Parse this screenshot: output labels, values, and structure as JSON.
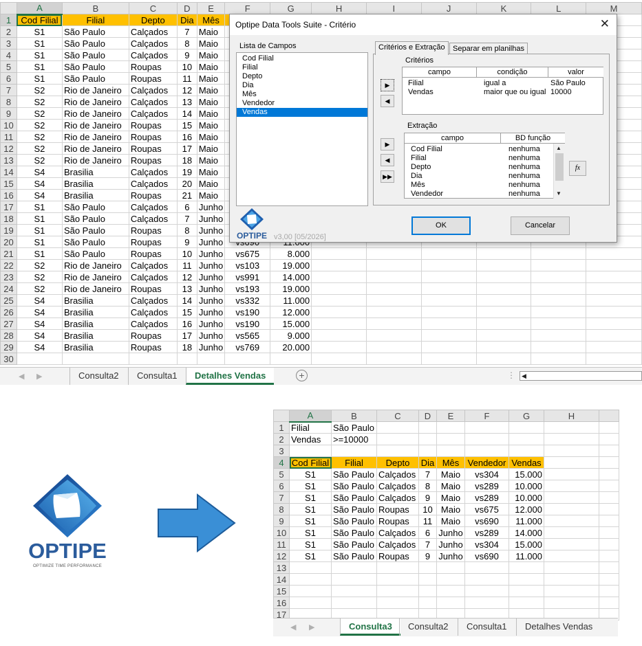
{
  "top_sheet": {
    "columns": [
      "A",
      "B",
      "C",
      "D",
      "E",
      "F",
      "G",
      "H",
      "I",
      "J",
      "K",
      "L",
      "M"
    ],
    "header_row": [
      "Cod Filial",
      "Filial",
      "Depto",
      "Dia",
      "Mês",
      "V",
      ""
    ],
    "rows": [
      [
        "S1",
        "São Paulo",
        "Calçados",
        "7",
        "Maio",
        "",
        ""
      ],
      [
        "S1",
        "São Paulo",
        "Calçados",
        "8",
        "Maio",
        "",
        ""
      ],
      [
        "S1",
        "São Paulo",
        "Calçados",
        "9",
        "Maio",
        "",
        ""
      ],
      [
        "S1",
        "São Paulo",
        "Roupas",
        "10",
        "Maio",
        "",
        ""
      ],
      [
        "S1",
        "São Paulo",
        "Roupas",
        "11",
        "Maio",
        "",
        ""
      ],
      [
        "S2",
        "Rio de Janeiro",
        "Calçados",
        "12",
        "Maio",
        "",
        ""
      ],
      [
        "S2",
        "Rio de Janeiro",
        "Calçados",
        "13",
        "Maio",
        "",
        ""
      ],
      [
        "S2",
        "Rio de Janeiro",
        "Calçados",
        "14",
        "Maio",
        "",
        ""
      ],
      [
        "S2",
        "Rio de Janeiro",
        "Roupas",
        "15",
        "Maio",
        "",
        ""
      ],
      [
        "S2",
        "Rio de Janeiro",
        "Roupas",
        "16",
        "Maio",
        "",
        ""
      ],
      [
        "S2",
        "Rio de Janeiro",
        "Roupas",
        "17",
        "Maio",
        "",
        ""
      ],
      [
        "S2",
        "Rio de Janeiro",
        "Roupas",
        "18",
        "Maio",
        "",
        ""
      ],
      [
        "S4",
        "Brasilia",
        "Calçados",
        "19",
        "Maio",
        "",
        ""
      ],
      [
        "S4",
        "Brasilia",
        "Calçados",
        "20",
        "Maio",
        "",
        ""
      ],
      [
        "S4",
        "Brasilia",
        "Roupas",
        "21",
        "Maio",
        "",
        ""
      ],
      [
        "S1",
        "São Paulo",
        "Calçados",
        "6",
        "Junho",
        "",
        ""
      ],
      [
        "S1",
        "São Paulo",
        "Calçados",
        "7",
        "Junho",
        "",
        ""
      ],
      [
        "S1",
        "São Paulo",
        "Roupas",
        "8",
        "Junho",
        "",
        ""
      ],
      [
        "S1",
        "São Paulo",
        "Roupas",
        "9",
        "Junho",
        "vs690",
        "11.000"
      ],
      [
        "S1",
        "São Paulo",
        "Roupas",
        "10",
        "Junho",
        "vs675",
        "8.000"
      ],
      [
        "S2",
        "Rio de Janeiro",
        "Calçados",
        "11",
        "Junho",
        "vs103",
        "19.000"
      ],
      [
        "S2",
        "Rio de Janeiro",
        "Calçados",
        "12",
        "Junho",
        "vs991",
        "14.000"
      ],
      [
        "S2",
        "Rio de Janeiro",
        "Roupas",
        "13",
        "Junho",
        "vs193",
        "19.000"
      ],
      [
        "S4",
        "Brasilia",
        "Calçados",
        "14",
        "Junho",
        "vs332",
        "11.000"
      ],
      [
        "S4",
        "Brasilia",
        "Calçados",
        "15",
        "Junho",
        "vs190",
        "12.000"
      ],
      [
        "S4",
        "Brasilia",
        "Calçados",
        "16",
        "Junho",
        "vs190",
        "15.000"
      ],
      [
        "S4",
        "Brasilia",
        "Roupas",
        "17",
        "Junho",
        "vs565",
        "9.000"
      ],
      [
        "S4",
        "Brasilia",
        "Roupas",
        "18",
        "Junho",
        "vs769",
        "20.000"
      ],
      [
        "",
        "",
        "",
        "",
        "",
        "",
        ""
      ]
    ],
    "tabs": [
      "Consulta2",
      "Consulta1",
      "Detalhes Vendas"
    ],
    "active_tab": "Detalhes Vendas"
  },
  "dialog": {
    "title": "Optipe Data Tools Suite - Critério",
    "close": "✕",
    "fields_label": "Lista de Campos",
    "fields": [
      "Cod Filial",
      "Filial",
      "Depto",
      "Dia",
      "Mês",
      "Vendedor",
      "Vendas"
    ],
    "selected_field": "Vendas",
    "tabs": [
      "Critérios e Extração",
      "Separar em planilhas"
    ],
    "criteria": {
      "label": "Critérios",
      "headers": [
        "campo",
        "condição",
        "valor"
      ],
      "rows": [
        [
          "Filial",
          "igual a",
          "São Paulo"
        ],
        [
          "Vendas",
          "maior que ou igual",
          "10000"
        ]
      ]
    },
    "extraction": {
      "label": "Extração",
      "headers": [
        "campo",
        "BD função"
      ],
      "rows": [
        [
          "Cod Filial",
          "nenhuma"
        ],
        [
          "Filial",
          "nenhuma"
        ],
        [
          "Depto",
          "nenhuma"
        ],
        [
          "Dia",
          "nenhuma"
        ],
        [
          "Mês",
          "nenhuma"
        ],
        [
          "Vendedor",
          "nenhuma"
        ]
      ]
    },
    "fx_label": "fx",
    "logo_word": "OPTIPE",
    "version": "v3,00 [05/2026]",
    "ok": "OK",
    "cancel": "Cancelar"
  },
  "logo": {
    "word": "OPTIPE",
    "tagline": "OPTIMIZE TIME PERFORMANCE"
  },
  "bottom_sheet": {
    "columns": [
      "A",
      "B",
      "C",
      "D",
      "E",
      "F",
      "G",
      "H"
    ],
    "criteria_rows": [
      [
        "Filial",
        "São Paulo"
      ],
      [
        "Vendas",
        ">=10000"
      ]
    ],
    "headers": [
      "Cod Filial",
      "Filial",
      "Depto",
      "Dia",
      "Mês",
      "Vendedor",
      "Vendas"
    ],
    "rows": [
      [
        "S1",
        "São Paulo",
        "Calçados",
        "7",
        "Maio",
        "vs304",
        "15.000"
      ],
      [
        "S1",
        "São Paulo",
        "Calçados",
        "8",
        "Maio",
        "vs289",
        "10.000"
      ],
      [
        "S1",
        "São Paulo",
        "Calçados",
        "9",
        "Maio",
        "vs289",
        "10.000"
      ],
      [
        "S1",
        "São Paulo",
        "Roupas",
        "10",
        "Maio",
        "vs675",
        "12.000"
      ],
      [
        "S1",
        "São Paulo",
        "Roupas",
        "11",
        "Maio",
        "vs690",
        "11.000"
      ],
      [
        "S1",
        "São Paulo",
        "Calçados",
        "6",
        "Junho",
        "vs289",
        "14.000"
      ],
      [
        "S1",
        "São Paulo",
        "Calçados",
        "7",
        "Junho",
        "vs304",
        "15.000"
      ],
      [
        "S1",
        "São Paulo",
        "Roupas",
        "9",
        "Junho",
        "vs690",
        "11.000"
      ]
    ],
    "tabs": [
      "Consulta3",
      "Consulta2",
      "Consulta1",
      "Detalhes Vendas"
    ],
    "active_tab": "Consulta3"
  },
  "colors": {
    "header_fill": "#ffc000",
    "excel_green": "#217346",
    "selection_blue": "#0078d7",
    "logo_blue": "#2b5c9c",
    "arrow_blue": "#3a8fd6"
  },
  "icons": [
    "close-icon",
    "arrow-right-icon",
    "arrow-left-icon",
    "double-arrow-right-icon",
    "fx-icon",
    "optipe-logo-icon",
    "big-arrow-icon",
    "plus-icon"
  ]
}
